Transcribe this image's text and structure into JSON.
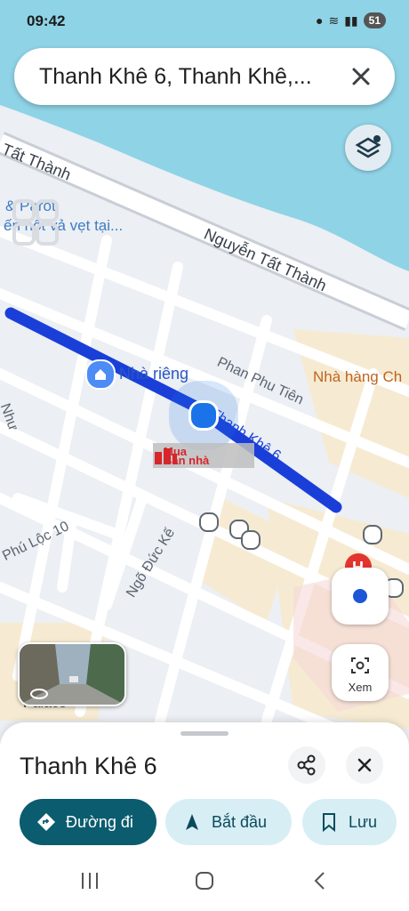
{
  "status": {
    "time": "09:42",
    "battery": "51"
  },
  "search": {
    "query": "Thanh Khê 6, Thanh Khê,..."
  },
  "map": {
    "labels": {
      "nguyen_tat_thanh_top": "Tất Thành",
      "nguyen_tat_thanh_main": "Nguyễn Tất Thành",
      "parot": "& Parot",
      "poi_snippet": "ến hột vả vẹt tại...",
      "nha_rieng": "Nhà riêng",
      "phan_phu_tien": "Phan Phu Tiên",
      "thanh_khe_6": "Thanh Khê 6",
      "nha_hang": "Nhà hàng Ch",
      "phu_loc_10": "Phú Lộc 10",
      "ngo_duc_ke": "Ngõ Đức Kế",
      "nhu": "Như",
      "palace": "Palace"
    },
    "watermark": {
      "line1": "Mua",
      "line2": "Bán nhà"
    },
    "route_color": "#1a3fd8",
    "water_color": "#8fd3e6"
  },
  "controls": {
    "xem_label": "Xem"
  },
  "sheet": {
    "title": "Thanh Khê 6",
    "actions": [
      {
        "label": "Đường đi",
        "icon": "directions-icon"
      },
      {
        "label": "Bắt đầu",
        "icon": "navigation-arrow-icon"
      },
      {
        "label": "Lưu",
        "icon": "bookmark-icon"
      }
    ]
  }
}
